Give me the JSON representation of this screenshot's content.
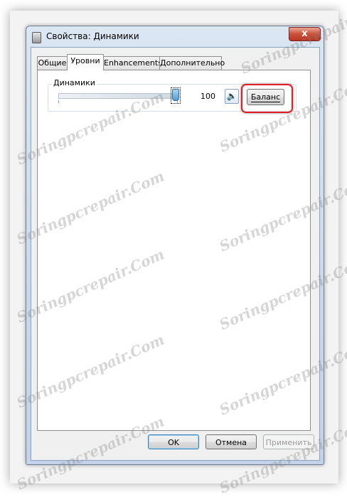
{
  "window": {
    "title": "Свойства: Динамики",
    "close_glyph": "x"
  },
  "tabs": [
    {
      "label": "Общие",
      "active": false
    },
    {
      "label": "Уровни",
      "active": true
    },
    {
      "label": "Enhancements",
      "active": false
    },
    {
      "label": "Дополнительно",
      "active": false
    }
  ],
  "levels": {
    "group_label": "Динамики",
    "value_label": "100",
    "level_fraction": 1.0,
    "mute_icon": "speaker-icon",
    "balance_button": "Баланс"
  },
  "buttons": {
    "ok": "OK",
    "cancel": "Отмена",
    "apply": "Применить"
  },
  "watermark_text": "Soringpcrepair.Com",
  "colors": {
    "highlight": "#e21d24",
    "title_bg": "#c9d9ec",
    "slider_thumb": "#4f9fd5"
  }
}
